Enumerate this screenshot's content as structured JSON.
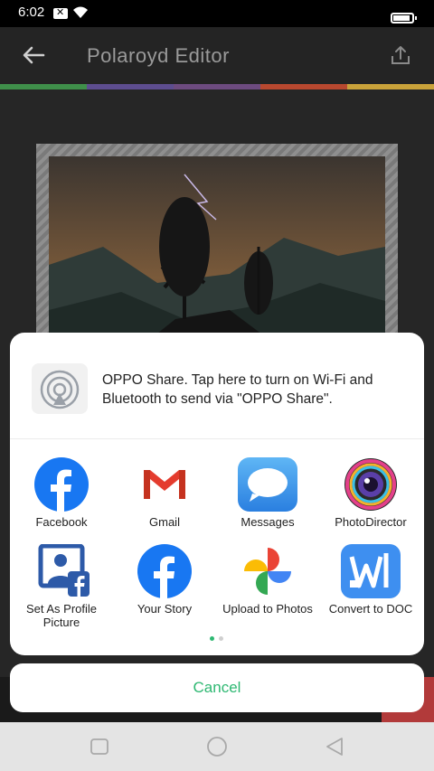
{
  "status_bar": {
    "time": "6:02"
  },
  "app_bar": {
    "title": "Polaroyd Editor"
  },
  "stripe_colors": [
    "#3f8f4a",
    "#5d4d8f",
    "#6d4b7f",
    "#b8482f",
    "#c9a23a"
  ],
  "share_sheet": {
    "oppo_share_text": "OPPO Share. Tap here to turn on Wi-Fi and Bluetooth to send via \"OPPO Share\".",
    "apps": [
      {
        "label": "Facebook",
        "icon": "facebook-icon"
      },
      {
        "label": "Gmail",
        "icon": "gmail-icon"
      },
      {
        "label": "Messages",
        "icon": "messages-icon"
      },
      {
        "label": "PhotoDirector",
        "icon": "photodirector-icon"
      },
      {
        "label": "Set As Profile Picture",
        "icon": "facebook-profile-icon"
      },
      {
        "label": "Your Story",
        "icon": "facebook-story-icon"
      },
      {
        "label": "Upload to Photos",
        "icon": "google-photos-icon"
      },
      {
        "label": "Convert to DOC",
        "icon": "convert-to-doc-icon"
      }
    ],
    "page_indicator": {
      "pages": 2,
      "current": 1
    }
  },
  "cancel_label": "Cancel",
  "colors": {
    "accent": "#2eb872",
    "facebook": "#1877f2"
  }
}
